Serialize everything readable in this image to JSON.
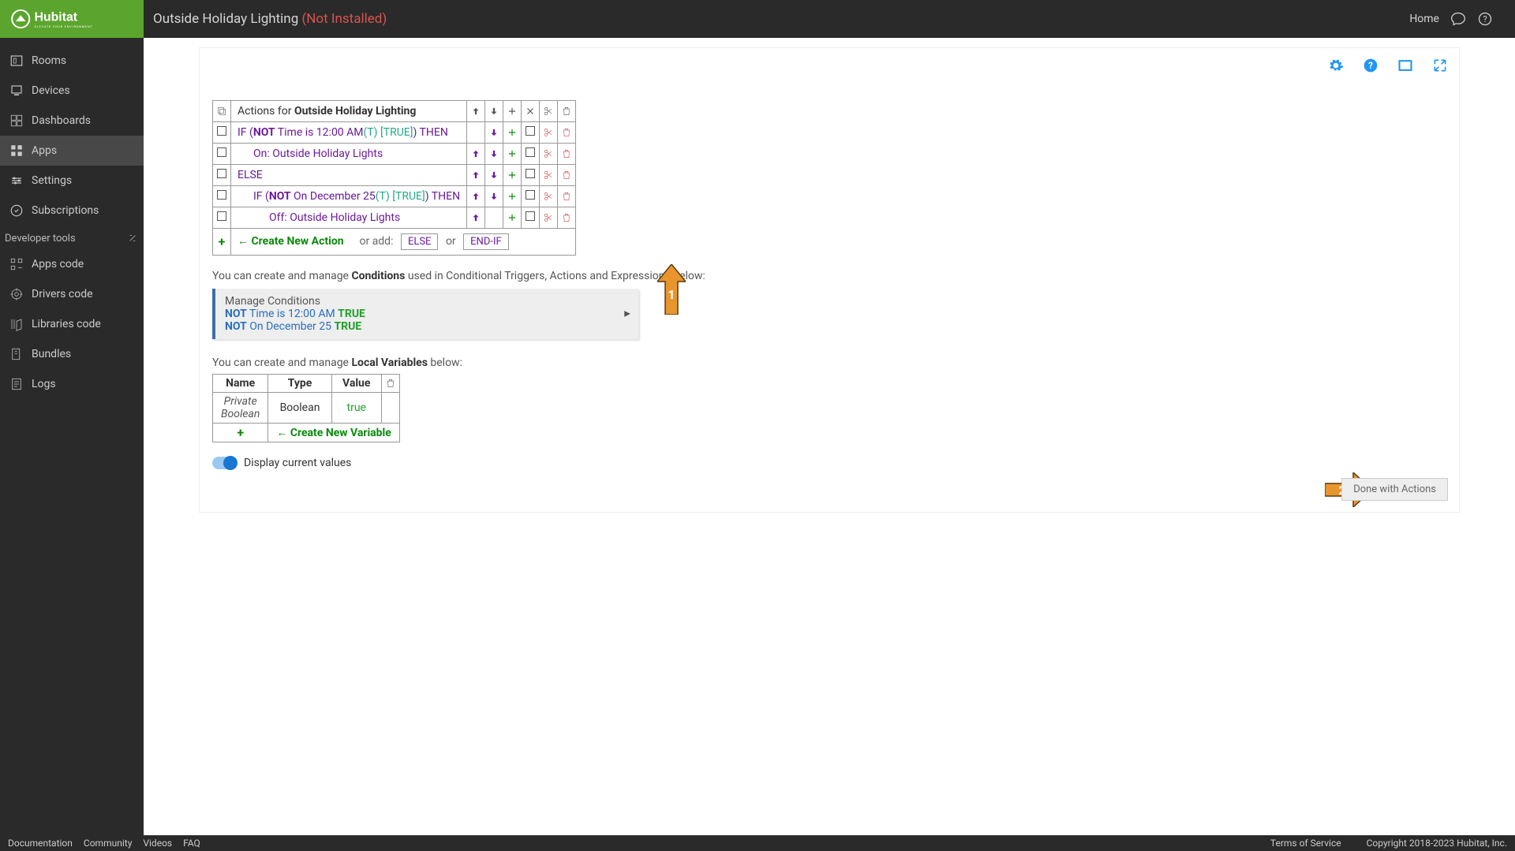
{
  "header": {
    "brand": "Hubitat",
    "brand_sub": "ELEVATE YOUR ENVIRONMENT",
    "title": "Outside Holiday Lighting",
    "status": "(Not Installed)",
    "home": "Home"
  },
  "sidebar": {
    "rooms": "Rooms",
    "devices": "Devices",
    "dashboards": "Dashboards",
    "apps": "Apps",
    "settings": "Settings",
    "subscriptions": "Subscriptions",
    "dev_header": "Developer tools",
    "apps_code": "Apps code",
    "drivers_code": "Drivers code",
    "libraries_code": "Libraries code",
    "bundles": "Bundles",
    "logs": "Logs"
  },
  "actions": {
    "header_prefix": "Actions for ",
    "header_name": "Outside Holiday Lighting",
    "rows": [
      {
        "indent": 0,
        "prefix": "IF (",
        "not": "NOT",
        "mid": " Time is 12:00 AM",
        "paren": "(T)",
        "truth": " [TRUE]",
        "suffix": ") THEN"
      },
      {
        "indent": 1,
        "text": "On: Outside Holiday Lights"
      },
      {
        "indent": 0,
        "text": "ELSE"
      },
      {
        "indent": 1,
        "prefix": "IF (",
        "not": "NOT",
        "mid": " On December 25",
        "paren": "(T)",
        "truth": " [TRUE]",
        "suffix": ") THEN"
      },
      {
        "indent": 2,
        "text": "Off: Outside Holiday Lights"
      }
    ],
    "create_label": "Create New Action",
    "or_add": "or add:",
    "else_chip": "ELSE",
    "or": "or",
    "endif_chip": "END-IF"
  },
  "conditions": {
    "desc_a": "You can create and manage ",
    "desc_b": "Conditions",
    "desc_c": " used in Conditional Triggers, Actions and Expressions below:",
    "box_title": "Manage Conditions",
    "lines": [
      {
        "not": "NOT",
        "txt": " Time is 12:00 AM ",
        "tr": "TRUE"
      },
      {
        "not": "NOT",
        "txt": " On December 25 ",
        "tr": "TRUE"
      }
    ]
  },
  "vars": {
    "desc_a": "You can create and manage ",
    "desc_b": "Local Variables",
    "desc_c": " below:",
    "cols": {
      "name": "Name",
      "type": "Type",
      "value": "Value"
    },
    "row": {
      "name": "Private Boolean",
      "type": "Boolean",
      "value": "true"
    },
    "create_label": "Create New Variable"
  },
  "switch_label": "Display current values",
  "done": "Done with Actions",
  "footer": {
    "doc": "Documentation",
    "com": "Community",
    "vid": "Videos",
    "faq": "FAQ",
    "tos": "Terms of Service",
    "copy": "Copyright 2018-2023 Hubitat, Inc."
  },
  "callouts": {
    "one": "1",
    "two": "2"
  }
}
